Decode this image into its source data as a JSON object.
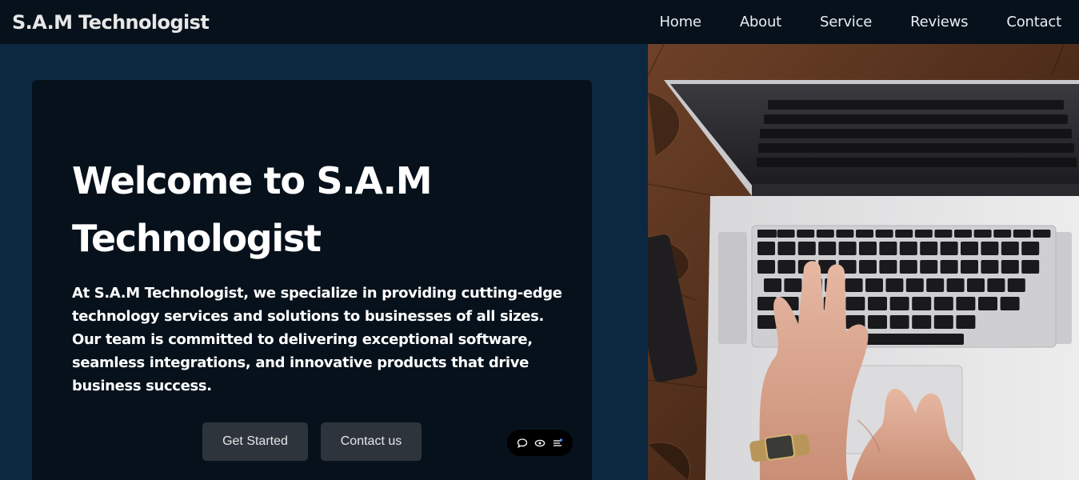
{
  "header": {
    "brand": "S.A.M Technologist",
    "nav": [
      {
        "label": "Home"
      },
      {
        "label": "About"
      },
      {
        "label": "Service"
      },
      {
        "label": "Reviews"
      },
      {
        "label": "Contact"
      }
    ]
  },
  "hero": {
    "title": "Welcome to S.A.M Technologist",
    "description": "At S.A.M Technologist, we specialize in providing cutting-edge technology services and solutions to businesses of all sizes. Our team is committed to delivering exceptional software, seamless integrations, and innovative products that drive business success.",
    "buttons": {
      "get_started": "Get Started",
      "contact_us": "Contact us"
    }
  },
  "widget": {
    "icons": [
      "chat-icon",
      "eye-icon",
      "menu-icon"
    ]
  },
  "photo": {
    "subject": "laptop-keyboard-hands-photo"
  },
  "colors": {
    "header_bg": "#06111b",
    "page_bg": "#0c2740",
    "card_bg": "#06111b",
    "button_bg": "#2e343c",
    "text": "#ffffff"
  }
}
